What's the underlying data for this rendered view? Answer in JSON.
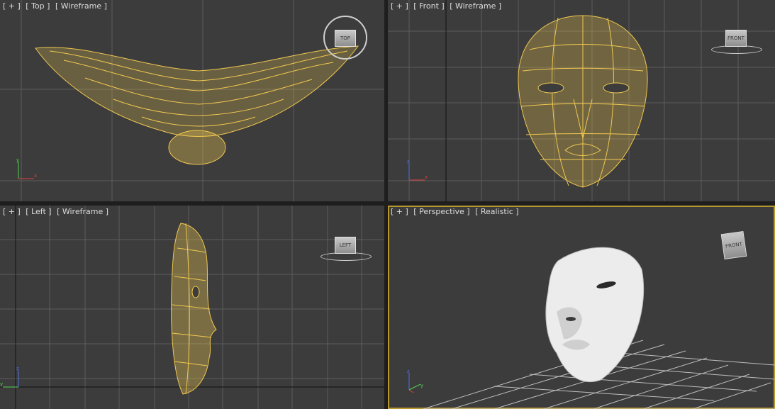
{
  "viewports": [
    {
      "plus": "[ + ]",
      "name": "[ Top ]",
      "mode": "[ Wireframe ]",
      "cube": "TOP"
    },
    {
      "plus": "[ + ]",
      "name": "[ Front ]",
      "mode": "[ Wireframe ]",
      "cube": "FRONT"
    },
    {
      "plus": "[ + ]",
      "name": "[ Left ]",
      "mode": "[ Wireframe ]",
      "cube": "LEFT"
    },
    {
      "plus": "[ + ]",
      "name": "[ Perspective ]",
      "mode": "[ Realistic ]",
      "cube": "FRONT"
    }
  ],
  "axes": {
    "top": [
      "y",
      "x"
    ],
    "front": [
      "z",
      "x"
    ],
    "left": [
      "z",
      "y"
    ],
    "persp": [
      "z",
      "y"
    ]
  },
  "colors": {
    "viewport_bg": "#3c3c3c",
    "grid": "#5c5c5c",
    "wire": "#f0c850",
    "active_border": "#b8962e"
  },
  "icons": [
    "view-cube-icon",
    "axis-tripod-icon",
    "compass-ring-icon"
  ]
}
